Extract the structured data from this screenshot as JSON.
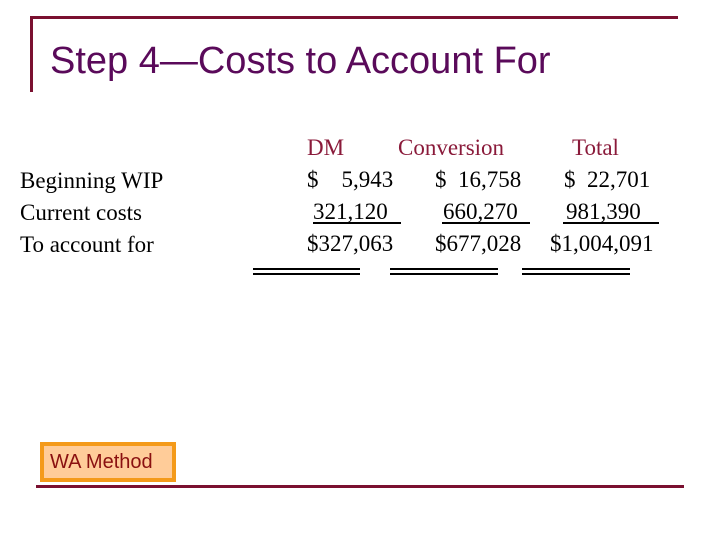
{
  "title": "Step 4—Costs to Account For",
  "row_labels": [
    "Beginning WIP",
    "Current costs",
    "To account for"
  ],
  "columns": [
    {
      "header": "DM",
      "values": [
        "$    5,943",
        "321,120",
        "$327,063"
      ]
    },
    {
      "header": "Conversion",
      "values": [
        "$  16,758",
        "660,270",
        "$677,028"
      ]
    },
    {
      "header": "Total",
      "values": [
        "$  22,701",
        "981,390",
        "$1,004,091"
      ]
    }
  ],
  "button": {
    "label": "WA Method"
  },
  "colors": {
    "frame": "#7a1030",
    "title": "#5a0a5a",
    "header": "#8a1a3a",
    "button_border": "#f49a1a",
    "button_fill": "#ffcc99",
    "button_text": "#8a1010"
  }
}
